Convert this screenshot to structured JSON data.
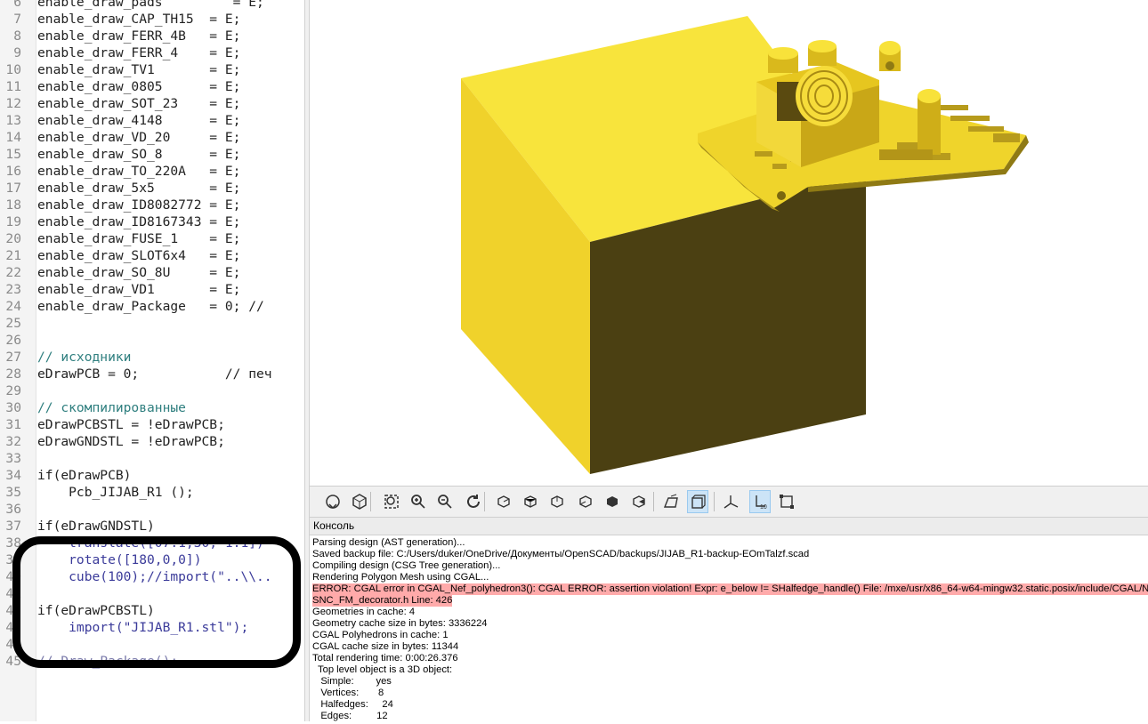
{
  "editor": {
    "lines": [
      {
        "n": "6",
        "t": "enable_draw_pads         = E;",
        "k": "normal"
      },
      {
        "n": "7",
        "t": "enable_draw_CAP_TH15  = E;",
        "k": "normal"
      },
      {
        "n": "8",
        "t": "enable_draw_FERR_4B   = E;",
        "k": "normal"
      },
      {
        "n": "9",
        "t": "enable_draw_FERR_4    = E;",
        "k": "normal"
      },
      {
        "n": "10",
        "t": "enable_draw_TV1       = E;",
        "k": "normal"
      },
      {
        "n": "11",
        "t": "enable_draw_0805      = E;",
        "k": "normal"
      },
      {
        "n": "12",
        "t": "enable_draw_SOT_23    = E;",
        "k": "normal"
      },
      {
        "n": "13",
        "t": "enable_draw_4148      = E;",
        "k": "normal"
      },
      {
        "n": "14",
        "t": "enable_draw_VD_20     = E;",
        "k": "normal"
      },
      {
        "n": "15",
        "t": "enable_draw_SO_8      = E;",
        "k": "normal"
      },
      {
        "n": "16",
        "t": "enable_draw_TO_220A   = E;",
        "k": "normal"
      },
      {
        "n": "17",
        "t": "enable_draw_5x5       = E;",
        "k": "normal"
      },
      {
        "n": "18",
        "t": "enable_draw_ID8082772 = E;",
        "k": "normal"
      },
      {
        "n": "19",
        "t": "enable_draw_ID8167343 = E;",
        "k": "normal"
      },
      {
        "n": "20",
        "t": "enable_draw_FUSE_1    = E;",
        "k": "normal"
      },
      {
        "n": "21",
        "t": "enable_draw_SLOT6x4   = E;",
        "k": "normal"
      },
      {
        "n": "22",
        "t": "enable_draw_SO_8U     = E;",
        "k": "normal"
      },
      {
        "n": "23",
        "t": "enable_draw_VD1       = E;",
        "k": "normal"
      },
      {
        "n": "24",
        "t": "enable_draw_Package   = 0; //",
        "k": "normal"
      },
      {
        "n": "25",
        "t": "",
        "k": "normal"
      },
      {
        "n": "26",
        "t": "",
        "k": "normal"
      },
      {
        "n": "27",
        "t": "// исходники",
        "k": "comment"
      },
      {
        "n": "28",
        "t": "eDrawPCB = 0;           // печ",
        "k": "mixed"
      },
      {
        "n": "29",
        "t": "",
        "k": "normal"
      },
      {
        "n": "30",
        "t": "// скомпилированные",
        "k": "comment"
      },
      {
        "n": "31",
        "t": "eDrawPCBSTL = !eDrawPCB;",
        "k": "normal"
      },
      {
        "n": "32",
        "t": "eDrawGNDSTL = !eDrawPCB;",
        "k": "normal"
      },
      {
        "n": "33",
        "t": "",
        "k": "normal"
      },
      {
        "n": "34",
        "t": "if(eDrawPCB)",
        "k": "kw"
      },
      {
        "n": "35",
        "t": "    Pcb_JIJAB_R1 ();",
        "k": "normal"
      },
      {
        "n": "36",
        "t": "",
        "k": "normal"
      },
      {
        "n": "37",
        "t": "if(eDrawGNDSTL)",
        "k": "kw"
      },
      {
        "n": "38",
        "t": "    translate([07.1,30, 1.1])",
        "k": "struck"
      },
      {
        "n": "39",
        "t": "    rotate([180,0,0])",
        "k": "struck"
      },
      {
        "n": "40",
        "t": "    cube(100);//import(\"..\\\\..",
        "k": "struck"
      },
      {
        "n": "41",
        "t": "",
        "k": "normal"
      },
      {
        "n": "42",
        "t": "if(eDrawPCBSTL)",
        "k": "kw"
      },
      {
        "n": "43",
        "t": "    import(\"JIJAB_R1.stl\");",
        "k": "struck"
      },
      {
        "n": "44",
        "t": "",
        "k": "normal"
      },
      {
        "n": "45",
        "t": "// Draw_Package();",
        "k": "fade"
      }
    ]
  },
  "toolbar": {
    "buttons": [
      {
        "icon": "preview-icon",
        "active": false
      },
      {
        "icon": "render-icon",
        "active": false
      },
      {
        "icon": "zoom-all-icon",
        "active": false
      },
      {
        "icon": "zoom-in-icon",
        "active": false
      },
      {
        "icon": "zoom-out-icon",
        "active": false
      },
      {
        "icon": "reset-view-icon",
        "active": false
      },
      {
        "icon": "view-right-icon",
        "active": false
      },
      {
        "icon": "view-top-icon",
        "active": false
      },
      {
        "icon": "view-bottom-icon",
        "active": false
      },
      {
        "icon": "view-left-icon",
        "active": false
      },
      {
        "icon": "view-front-icon",
        "active": false
      },
      {
        "icon": "view-back-icon",
        "active": false
      },
      {
        "icon": "perspective-icon",
        "active": false
      },
      {
        "icon": "orthogonal-icon",
        "active": true
      },
      {
        "icon": "show-axes-icon",
        "active": false
      },
      {
        "icon": "show-scale-markers-icon",
        "active": true
      },
      {
        "icon": "show-edges-icon",
        "active": false
      }
    ]
  },
  "console": {
    "title": "Консоль",
    "lines": [
      {
        "t": "Parsing design (AST generation)...",
        "k": "normal"
      },
      {
        "t": "Saved backup file: C:/Users/duker/OneDrive/Документы/OpenSCAD/backups/JIJAB_R1-backup-EOmTalzf.scad",
        "k": "normal"
      },
      {
        "t": "Compiling design (CSG Tree generation)...",
        "k": "normal"
      },
      {
        "t": "Rendering Polygon Mesh using CGAL...",
        "k": "normal"
      },
      {
        "t": "ERROR: CGAL error in CGAL_Nef_polyhedron3(): CGAL ERROR: assertion violation! Expr: e_below != SHalfedge_handle() File: /mxe/usr/x86_64-w64-mingw32.static.posix/include/CGAL/Nef_3/",
        "k": "error"
      },
      {
        "t": "SNC_FM_decorator.h Line: 426",
        "k": "error"
      },
      {
        "t": "Geometries in cache: 4",
        "k": "normal"
      },
      {
        "t": "Geometry cache size in bytes: 3336224",
        "k": "normal"
      },
      {
        "t": "CGAL Polyhedrons in cache: 1",
        "k": "normal"
      },
      {
        "t": "CGAL cache size in bytes: 11344",
        "k": "normal"
      },
      {
        "t": "Total rendering time: 0:00:26.376",
        "k": "normal"
      },
      {
        "t": "  Top level object is a 3D object:",
        "k": "normal"
      },
      {
        "t": "   Simple:        yes",
        "k": "normal"
      },
      {
        "t": "   Vertices:       8",
        "k": "normal"
      },
      {
        "t": "   Halfedges:     24",
        "k": "normal"
      },
      {
        "t": "   Edges:         12",
        "k": "normal"
      }
    ]
  },
  "colors": {
    "model_top": "#f8e23a",
    "model_front": "#f0d22b",
    "model_side": "#4a3f10",
    "error_bg": "#ffaaaa",
    "comment": "#2f7f7f"
  }
}
